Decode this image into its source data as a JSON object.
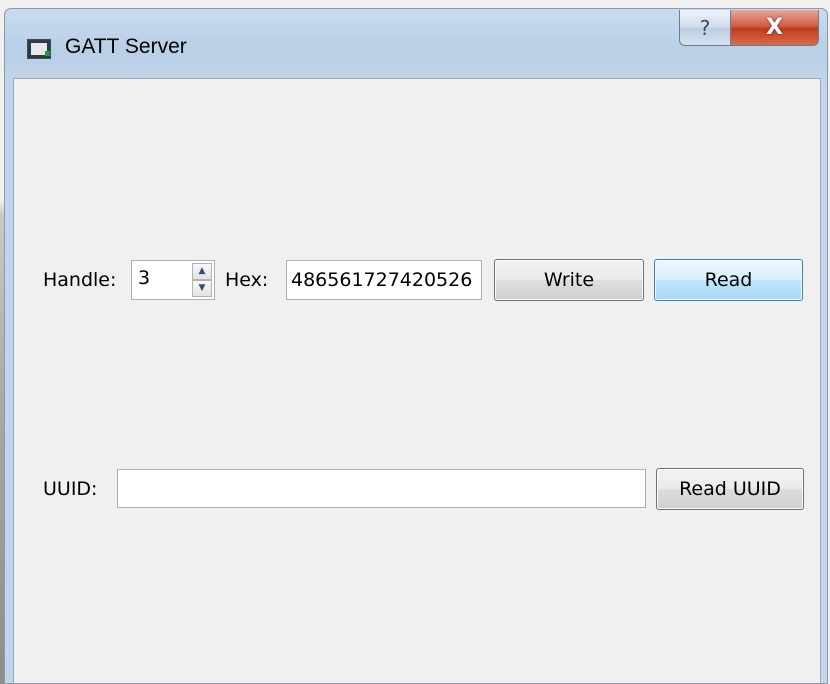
{
  "window": {
    "title": "GATT Server",
    "help_glyph": "?",
    "close_glyph": "X"
  },
  "handle_row": {
    "handle_label": "Handle:",
    "handle_value": "3",
    "spin_up_glyph": "▲",
    "spin_down_glyph": "▼",
    "hex_label": "Hex:",
    "hex_value": "486561727420526",
    "write_label": "Write",
    "read_label": "Read"
  },
  "uuid_row": {
    "uuid_label": "UUID:",
    "uuid_value": "",
    "read_uuid_label": "Read UUID"
  },
  "icons": {
    "app": "app-window-icon",
    "help": "help-icon",
    "close": "close-icon",
    "spin_up": "chevron-up-icon",
    "spin_down": "chevron-down-icon"
  },
  "colors": {
    "titlebar": "#b9cfe6",
    "client_background": "#f0f0f0",
    "close_button": "#c23b1d",
    "default_button": "#bee6fd"
  }
}
